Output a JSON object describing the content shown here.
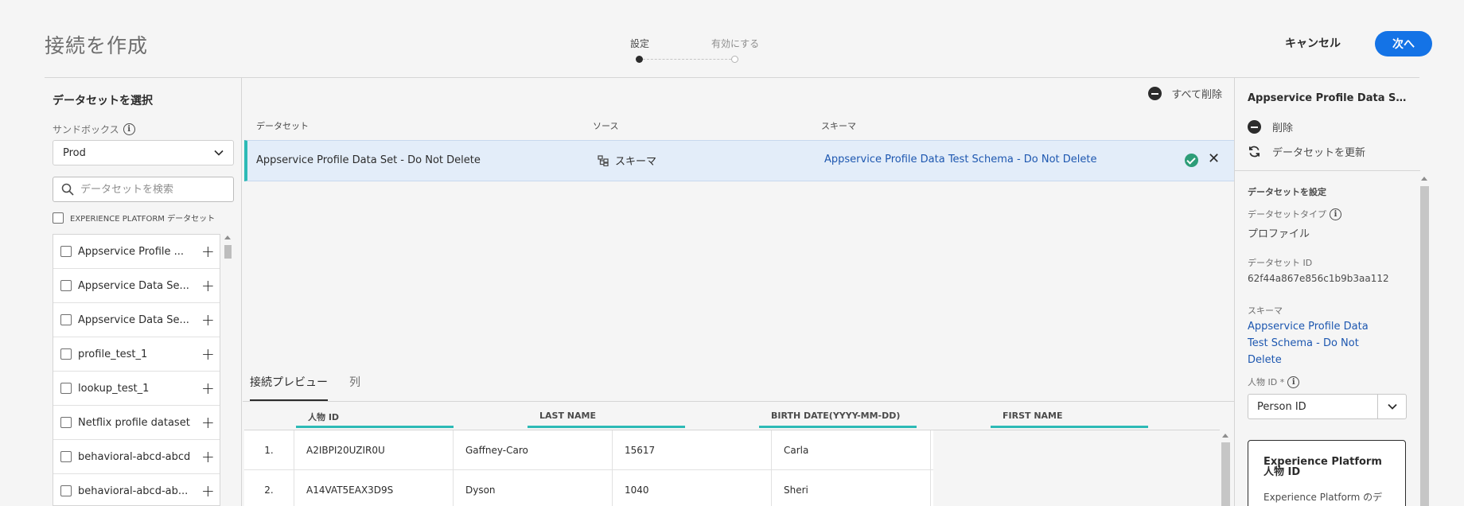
{
  "header": {
    "title": "接続を作成",
    "steps": [
      "設定",
      "有効にする"
    ],
    "cancel_label": "キャンセル",
    "next_label": "次へ"
  },
  "left_panel": {
    "heading": "データセットを選択",
    "sandbox_label": "サンドボックス",
    "sandbox_value": "Prod",
    "search_placeholder": "データセットを検索",
    "experience_platform_label": "EXPERIENCE PLATFORM データセット",
    "datasets": [
      "Appservice Profile ...",
      "Appservice Data Se...",
      "Appservice Data Se...",
      "profile_test_1",
      "lookup_test_1",
      "Netflix profile dataset",
      "behavioral-abcd-abcd",
      "behavioral-abcd-ab..."
    ]
  },
  "main": {
    "remove_all_label": "すべて削除",
    "columns": {
      "dataset": "データセット",
      "source": "ソース",
      "schema": "スキーマ"
    },
    "selected_row": {
      "dataset": "Appservice Profile Data Set - Do Not Delete",
      "source": "スキーマ",
      "schema": "Appservice Profile Data Test Schema - Do Not Delete"
    },
    "tabs": [
      "接続プレビュー",
      "列"
    ],
    "preview": {
      "headers": [
        "人物 ID",
        "LAST NAME",
        "BIRTH DATE(YYYY-MM-DD)",
        "FIRST NAME"
      ],
      "rows": [
        {
          "num": "1.",
          "cells": [
            "A2IBPI20UZIR0U",
            "Gaffney-Caro",
            "15617",
            "Carla"
          ]
        },
        {
          "num": "2.",
          "cells": [
            "A14VAT5EAX3D9S",
            "Dyson",
            "1040",
            "Sheri"
          ]
        }
      ]
    }
  },
  "right_panel": {
    "title": "Appservice Profile Data Set - Do Not Delete",
    "delete_label": "削除",
    "refresh_label": "データセットを更新",
    "section_heading": "データセットを設定",
    "dataset_type_label": "データセットタイプ",
    "dataset_type_value": "プロファイル",
    "dataset_id_label": "データセット ID",
    "dataset_id_value": "62f44a867e856c1b9b3aa112",
    "schema_label": "スキーマ",
    "schema_value": "Appservice Profile Data Test Schema - Do Not Delete",
    "person_id_label": "人物 ID *",
    "person_id_value": "Person ID",
    "card_title": "Experience Platform 人物 ID",
    "card_subtitle": "Experience Platform のデ"
  },
  "colors": {
    "accent": "#1473e6",
    "link": "#1d57b0",
    "teal": "#2dbab6",
    "success": "#2d9d78",
    "selected_row_bg": "#e3edf9"
  }
}
